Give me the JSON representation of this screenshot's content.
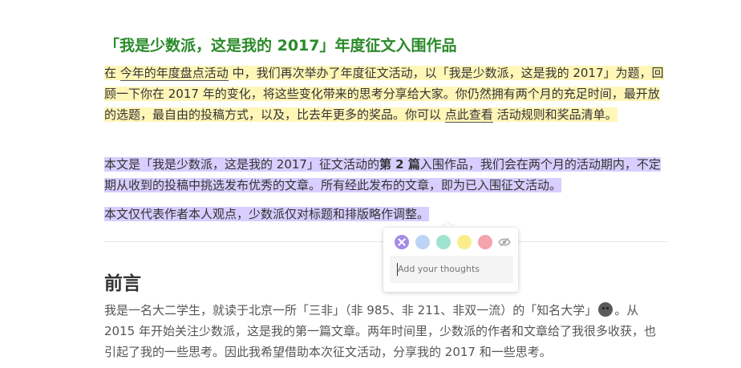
{
  "article": {
    "title": "「我是少数派，这是我的 2017」年度征文入围作品",
    "intro": {
      "part1": "在 ",
      "link1": "今年的年度盘点活动",
      "part2": " 中，我们再次举办了年度征文活动，以「我是少数派，这是我的 2017」为题，回顾一下你在 2017 年的变化，将这些变化带来的思考分享给大家。你仍然拥有两个月的充足时间，最开放的选题，最自由的投稿方式，以及，比去年更多的奖品。你可以 ",
      "link2": "点此查看",
      "part3": " 活动规则和奖品清单。"
    },
    "note": {
      "part1": "本文是「我是少数派，这是我的 2017」征文活动的",
      "bold": "第 2 篇",
      "part2": "入围作品，我们会在两个月的活动期内，不定期从收到的投稿中挑选发布优秀的文章。所有经此发布的文章，即为已入围征文活动。"
    },
    "disclaimer": "本文仅代表作者本人观点，少数派仅对标题和排版略作调整。",
    "section_heading": "前言",
    "body": {
      "part1": "我是一名大二学生，就读于北京一所「三非」（非 985、非 211、非双一流）的「知名大学」",
      "part2": "。从 2015 年开始关注少数派，这是我的第一篇文章。两年时间里，少数派的作者和文章给了我很多收获，也引起了我的一些思考。因此我希望借助本次征文活动，分享我的 2017 和一些思考。"
    }
  },
  "popup": {
    "colors": {
      "close": "#a38be8",
      "blue": "#bcd4f5",
      "green": "#9ee3cf",
      "yellow": "#fbee8a",
      "pink": "#f5a3ad"
    },
    "icons": [
      "close-icon",
      "eye-slash-icon"
    ],
    "status": "saved",
    "placeholder": "Add your thoughts"
  },
  "highlight_colors": {
    "yellow": "#fff6b8",
    "purple": "#d8ceff"
  }
}
